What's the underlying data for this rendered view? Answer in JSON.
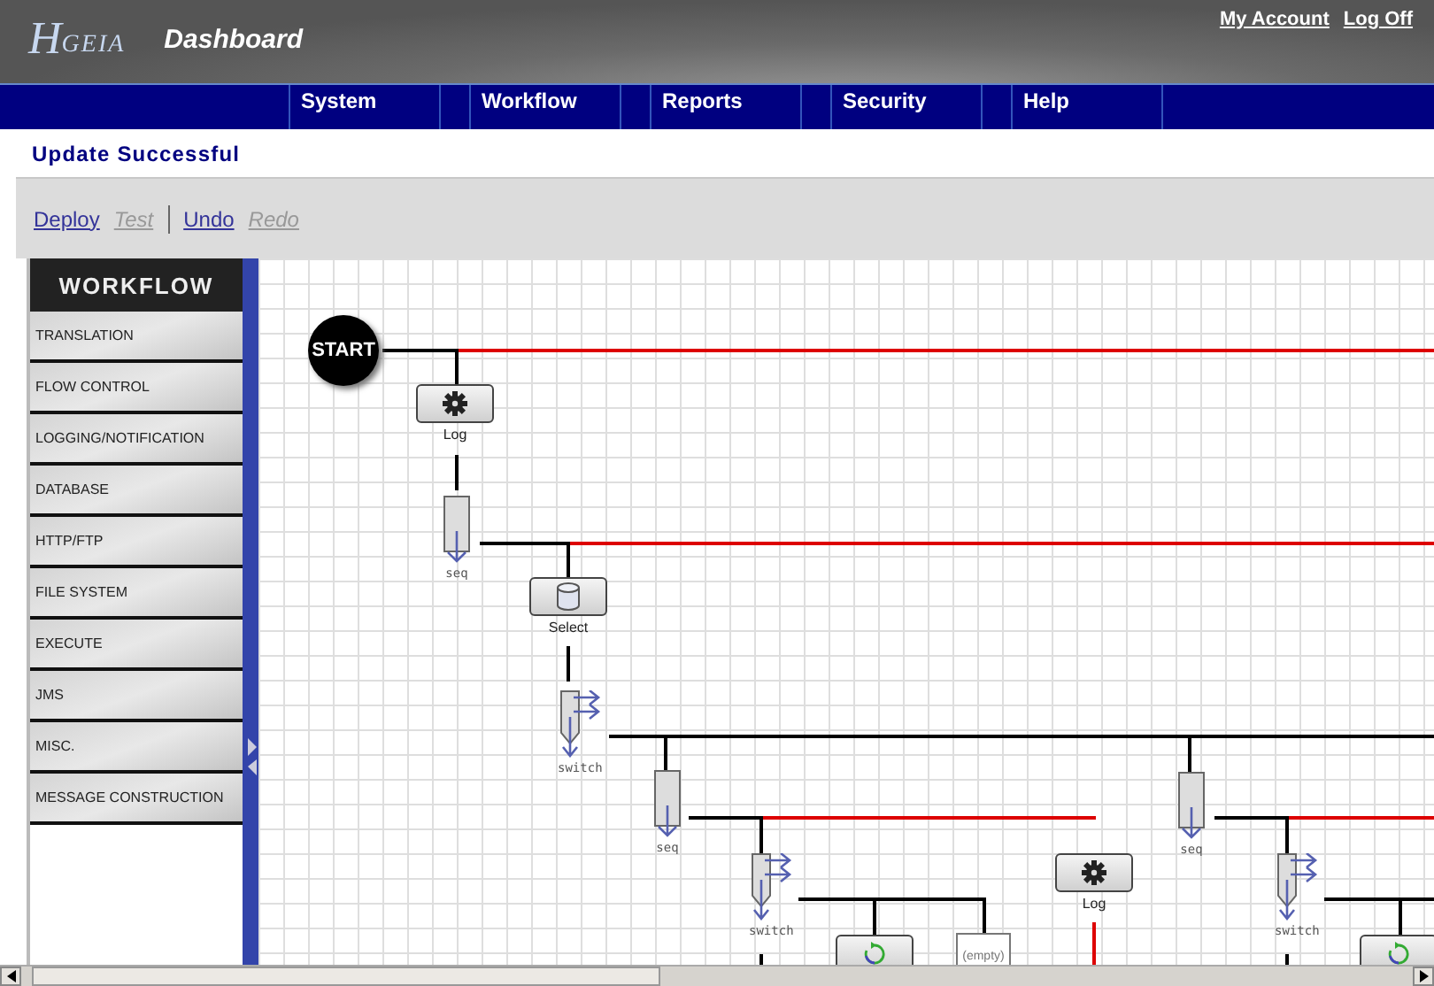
{
  "header": {
    "logo": {
      "letter": "H",
      "name": "GEIA"
    },
    "title": "Dashboard",
    "account_links": [
      "My Account",
      "Log Off"
    ]
  },
  "nav": [
    "System",
    "Workflow",
    "Reports",
    "Security",
    "Help"
  ],
  "status_message": "Update Successful",
  "toolbar": [
    {
      "kind": "link",
      "label": "Deploy",
      "disabled": false
    },
    {
      "kind": "link",
      "label": "Test",
      "disabled": true
    },
    {
      "kind": "separator"
    },
    {
      "kind": "link",
      "label": "Undo",
      "disabled": false
    },
    {
      "kind": "link",
      "label": "Redo",
      "disabled": true
    }
  ],
  "sidebar": {
    "title": "WORKFLOW",
    "items": [
      "TRANSLATION",
      "FLOW CONTROL",
      "LOGGING/NOTIFICATION",
      "DATABASE",
      "HTTP/FTP",
      "FILE SYSTEM",
      "EXECUTE",
      "JMS",
      "MISC.",
      "MESSAGE CONSTRUCTION"
    ]
  },
  "diagram": {
    "nodes": [
      {
        "kind": "start",
        "label": "START"
      },
      {
        "kind": "log",
        "label": "Log"
      },
      {
        "kind": "seq",
        "label": "seq"
      },
      {
        "kind": "select",
        "label": "Select"
      },
      {
        "kind": "switch",
        "label": "switch"
      },
      {
        "kind": "seq",
        "label": "seq"
      },
      {
        "kind": "switch",
        "label": "switch"
      },
      {
        "kind": "loop"
      },
      {
        "kind": "empty",
        "label": "(empty)"
      },
      {
        "kind": "log",
        "label": "Log"
      },
      {
        "kind": "seq",
        "label": "seq"
      },
      {
        "kind": "switch",
        "label": "switch"
      },
      {
        "kind": "loop"
      }
    ],
    "connectors": [
      {
        "color": "#000000"
      },
      {
        "color": "#dd0000"
      },
      {
        "color": "#000000"
      },
      {
        "color": "#000000"
      },
      {
        "color": "#000000"
      },
      {
        "color": "#dd0000"
      },
      {
        "color": "#000000"
      },
      {
        "color": "#000000"
      },
      {
        "color": "#000000"
      },
      {
        "color": "#000000"
      },
      {
        "color": "#000000"
      },
      {
        "color": "#000000"
      },
      {
        "color": "#dd0000"
      },
      {
        "color": "#000000"
      },
      {
        "color": "#000000"
      },
      {
        "color": "#000000"
      },
      {
        "color": "#000000"
      },
      {
        "color": "#000000"
      },
      {
        "color": "#dd0000"
      },
      {
        "color": "#000000"
      },
      {
        "color": "#dd0000"
      },
      {
        "color": "#000000"
      },
      {
        "color": "#000000"
      },
      {
        "color": "#000000"
      },
      {
        "color": "#000000"
      }
    ]
  }
}
